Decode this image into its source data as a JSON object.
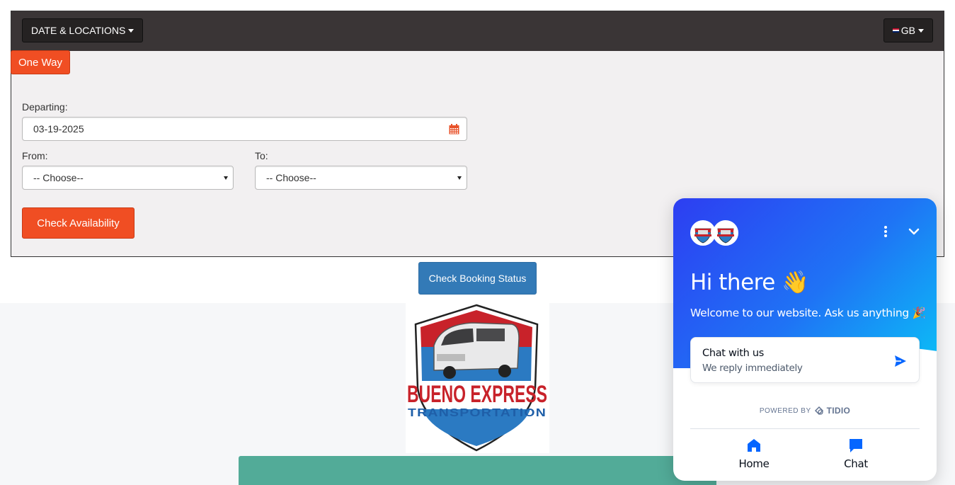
{
  "booking": {
    "dates_button": "DATE & LOCATIONS",
    "language_button": "GB",
    "trip_type": "One Way",
    "departing_label": "Departing:",
    "departing_value": "03-19-2025",
    "from_label": "From:",
    "from_value": "-- Choose--",
    "to_label": "To:",
    "to_value": "-- Choose--",
    "check_availability": "Check Availability",
    "accent_color": "#f04e23"
  },
  "check_booking_status": "Check Booking Status",
  "logo": {
    "line1": "BUENO EXPRESS",
    "line2": "TRANSPORTATION"
  },
  "chat": {
    "greeting": "Hi there 👋",
    "welcome": "Welcome to our website. Ask us anything 🎉",
    "card_title": "Chat with us",
    "card_subtitle": "We reply immediately",
    "powered_by": "POWERED BY",
    "brand": "TIDIO",
    "nav_home": "Home",
    "nav_chat": "Chat",
    "accent_color": "#0566ff"
  }
}
